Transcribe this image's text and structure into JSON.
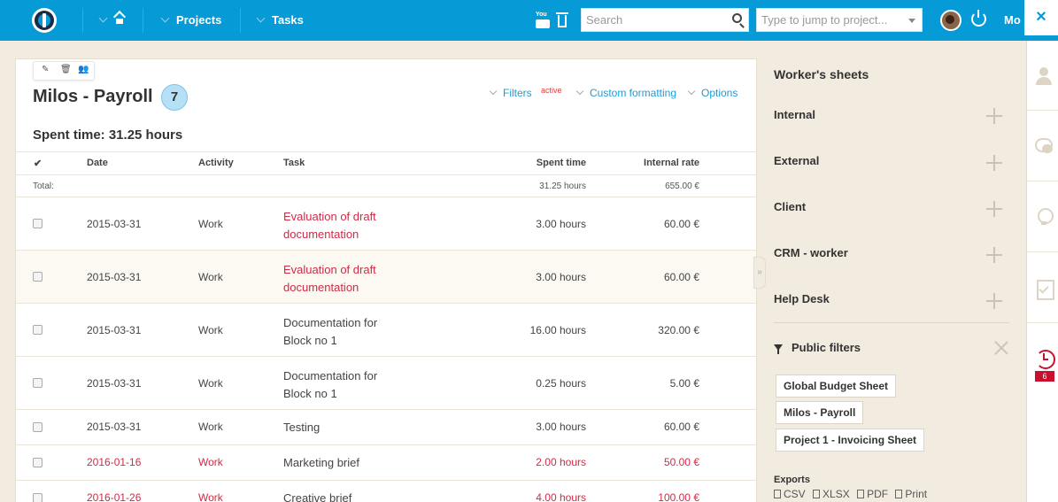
{
  "topbar": {
    "nav": [
      "Projects",
      "Tasks"
    ],
    "search_placeholder": "Search",
    "jump_placeholder": "Type to jump to project...",
    "more_label": "Mo",
    "close_label": "×",
    "youtube_label": "You"
  },
  "panel": {
    "title": "Milos - Payroll",
    "count": "7",
    "links": {
      "filters": "Filters",
      "filters_tag": "active",
      "custom": "Custom formatting",
      "options": "Options"
    },
    "spent_heading": "Spent time: 31.25 hours",
    "columns": {
      "check": "✔",
      "date": "Date",
      "activity": "Activity",
      "task": "Task",
      "spent": "Spent time",
      "rate": "Internal rate"
    },
    "total": {
      "label": "Total:",
      "spent": "31.25 hours",
      "rate": "655.00 €"
    },
    "rows": [
      {
        "date": "2015-03-31",
        "activity": "Work",
        "task": "Evaluation of draft documentation",
        "spent": "3.00 hours",
        "rate": "60.00 €"
      },
      {
        "date": "2015-03-31",
        "activity": "Work",
        "task": "Evaluation of draft documentation",
        "spent": "3.00 hours",
        "rate": "60.00 €"
      },
      {
        "date": "2015-03-31",
        "activity": "Work",
        "task": "Documentation for Block no 1",
        "spent": "16.00 hours",
        "rate": "320.00 €"
      },
      {
        "date": "2015-03-31",
        "activity": "Work",
        "task": "Documentation for Block no 1",
        "spent": "0.25 hours",
        "rate": "5.00 €"
      },
      {
        "date": "2015-03-31",
        "activity": "Work",
        "task": "Testing",
        "spent": "3.00 hours",
        "rate": "60.00 €"
      },
      {
        "date": "2016-01-16",
        "activity": "Work",
        "task": "Marketing brief",
        "spent": "2.00 hours",
        "rate": "50.00 €"
      },
      {
        "date": "2016-01-26",
        "activity": "Work",
        "task": "Creative brief",
        "spent": "4.00 hours",
        "rate": "100.00 €"
      }
    ]
  },
  "sidebar": {
    "title": "Worker's sheets",
    "sheets": [
      "Internal",
      "External",
      "Client",
      "CRM - worker",
      "Help Desk"
    ],
    "public_filters_title": "Public filters",
    "public_filters": [
      "Global Budget Sheet",
      "Milos - Payroll",
      "Project 1 - Invoicing Sheet"
    ],
    "exports_title": "Exports",
    "exports": [
      "CSV",
      "XLSX",
      "PDF",
      "Print"
    ]
  },
  "rail": {
    "badge": "6"
  },
  "colors": {
    "topbar": "#069ad6",
    "accent_red": "#cf2b47",
    "link_blue": "#1e9bd7",
    "badge_blue": "#b5e0f5"
  }
}
